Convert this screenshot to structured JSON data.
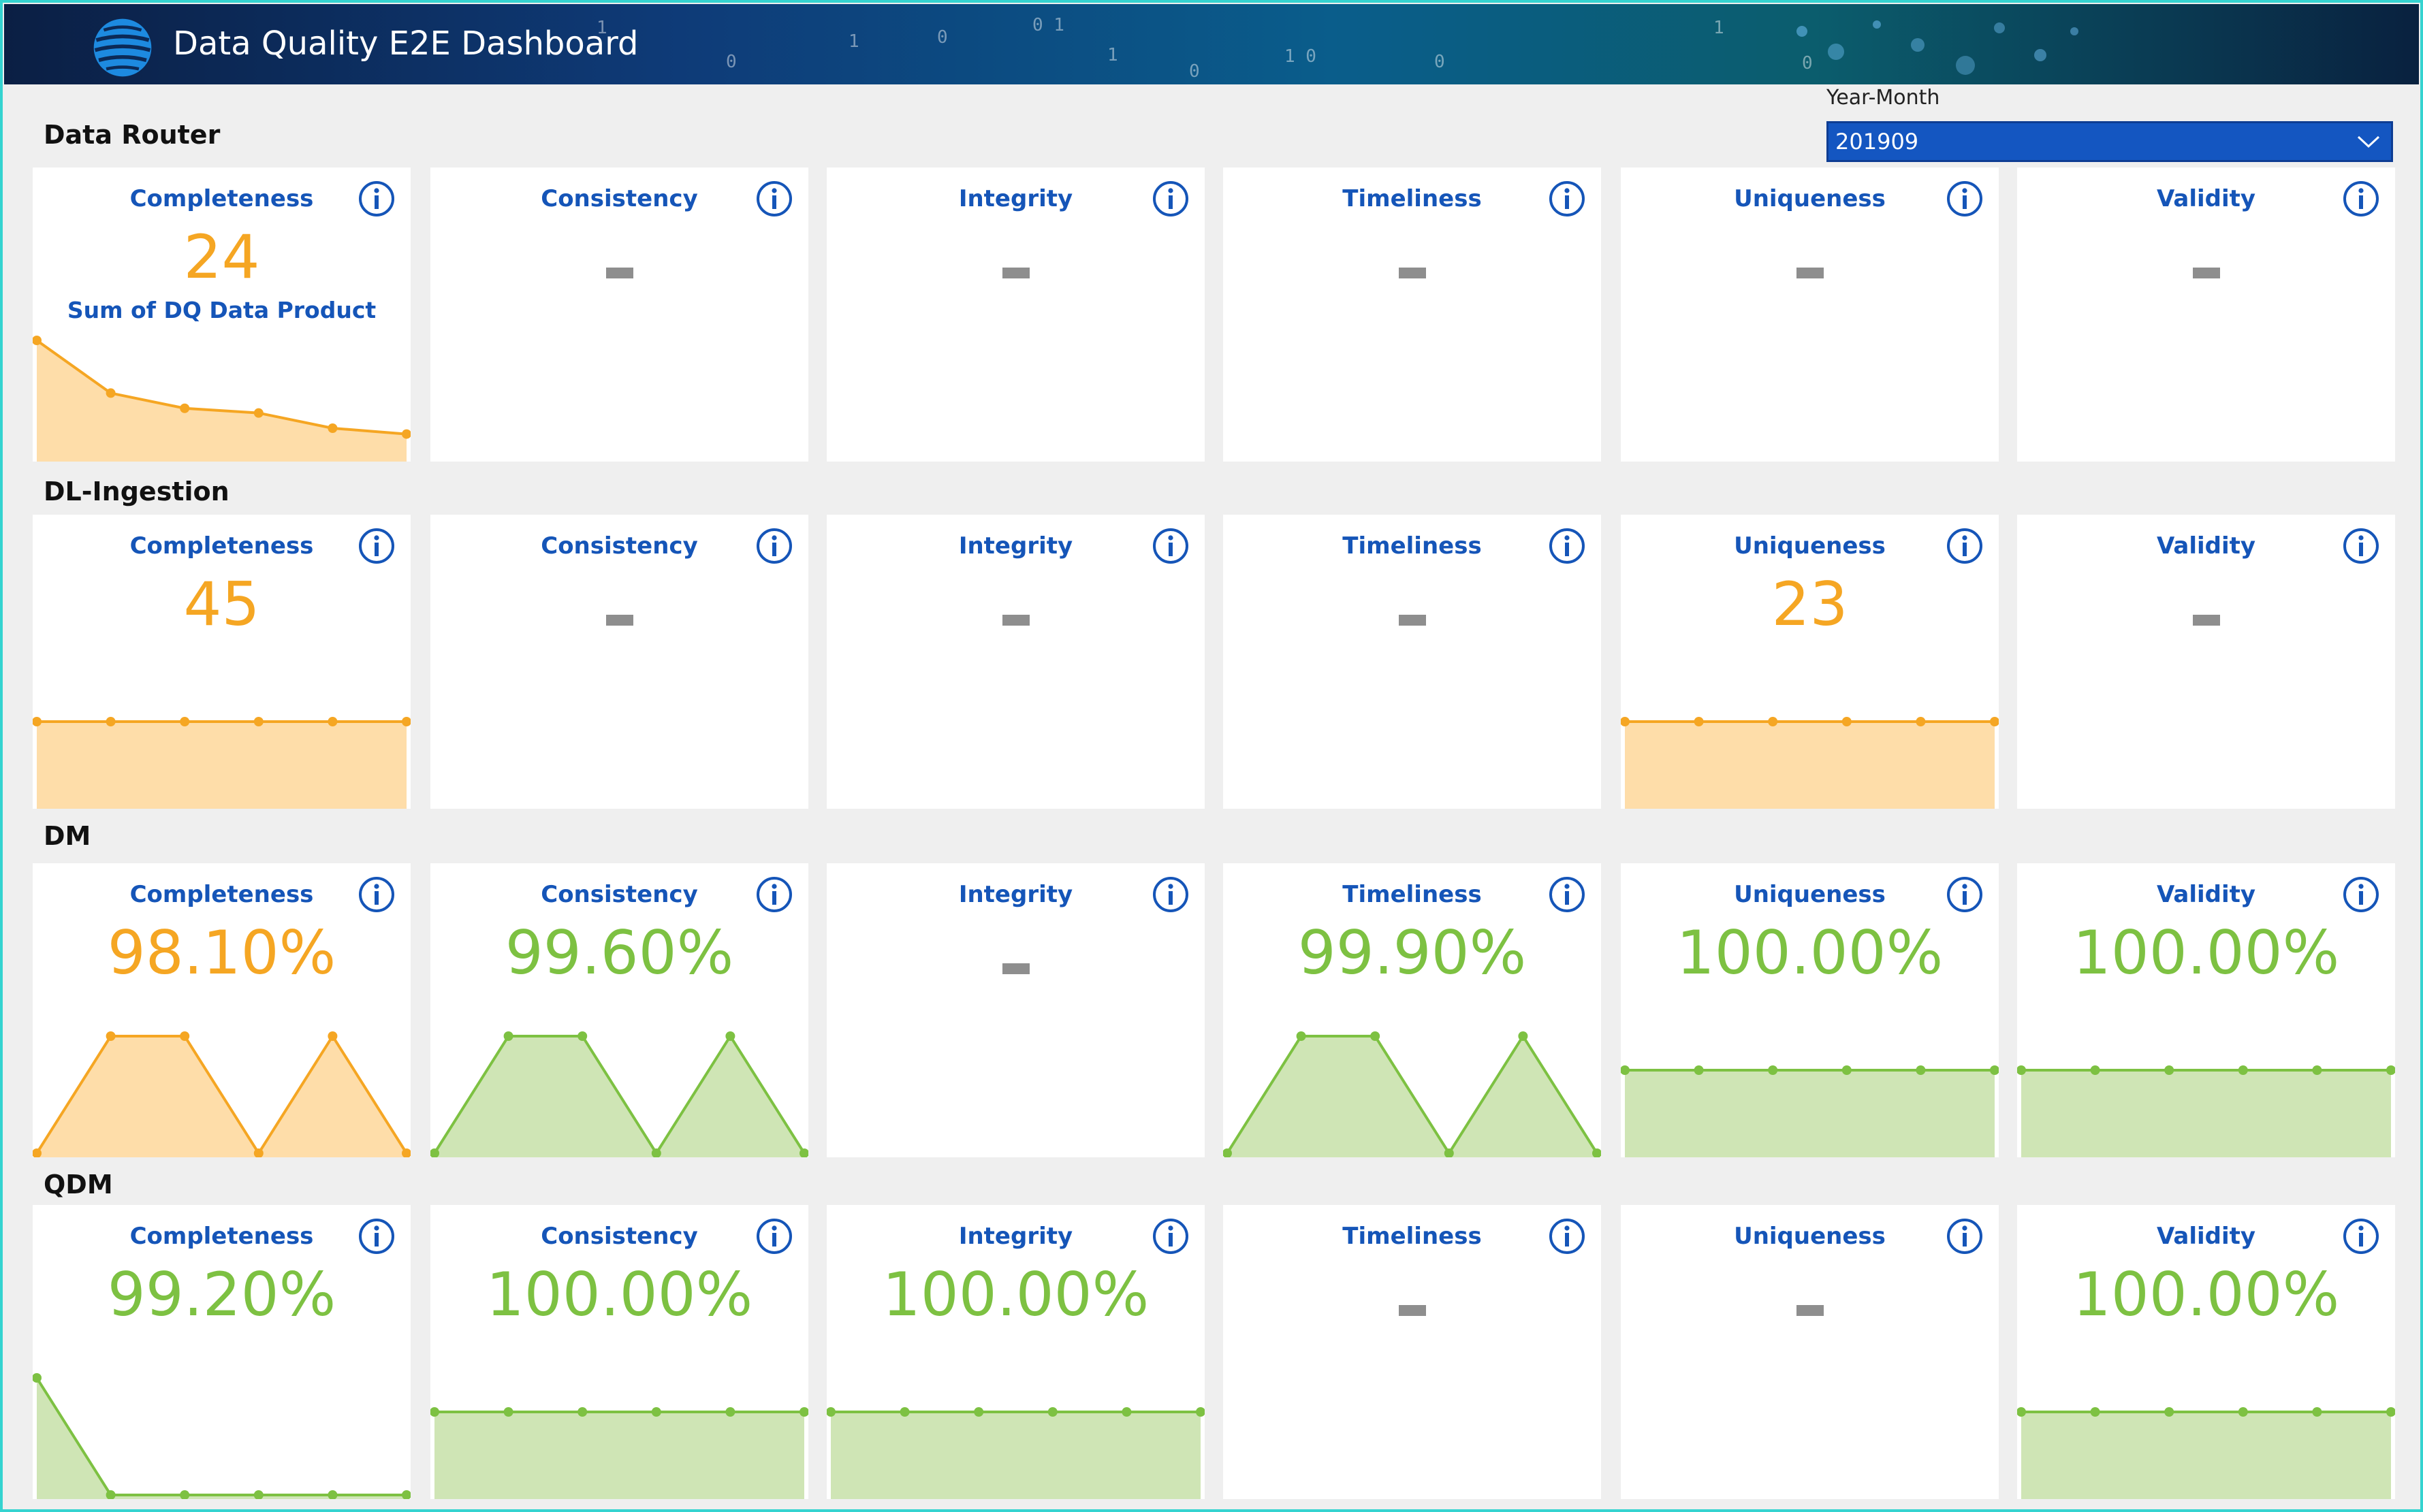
{
  "app": {
    "title": "Data Quality E2E Dashboard"
  },
  "filter": {
    "label": "Year-Month",
    "value": "201909"
  },
  "colors": {
    "amber": "#f5a623",
    "amber_fill": "#fedda9",
    "green": "#7dc142",
    "green_fill": "#cfe5b5",
    "title_blue": "#1555b8"
  },
  "sections": [
    {
      "label": "Data Router",
      "cards": [
        {
          "title": "Completeness",
          "value": "24",
          "sublabel": "Sum of DQ Data Product",
          "color": "amber",
          "spark": [
            1.0,
            0.55,
            0.42,
            0.38,
            0.25,
            0.2
          ]
        },
        {
          "title": "Consistency",
          "value": null
        },
        {
          "title": "Integrity",
          "value": null
        },
        {
          "title": "Timeliness",
          "value": null
        },
        {
          "title": "Uniqueness",
          "value": null
        },
        {
          "title": "Validity",
          "value": null
        }
      ]
    },
    {
      "label": "DL-Ingestion",
      "cards": [
        {
          "title": "Completeness",
          "value": "45",
          "color": "amber",
          "spark": [
            1,
            1,
            1,
            1,
            1,
            1
          ]
        },
        {
          "title": "Consistency",
          "value": null
        },
        {
          "title": "Integrity",
          "value": null
        },
        {
          "title": "Timeliness",
          "value": null
        },
        {
          "title": "Uniqueness",
          "value": "23",
          "color": "amber",
          "spark": [
            1,
            1,
            1,
            1,
            1,
            1
          ]
        },
        {
          "title": "Validity",
          "value": null
        }
      ]
    },
    {
      "label": "DM",
      "cards": [
        {
          "title": "Completeness",
          "value": "98.10%",
          "color": "amber",
          "spark": [
            0,
            1,
            1,
            0,
            1,
            0
          ]
        },
        {
          "title": "Consistency",
          "value": "99.60%",
          "color": "green",
          "spark": [
            0,
            1,
            1,
            0,
            1,
            0
          ]
        },
        {
          "title": "Integrity",
          "value": null
        },
        {
          "title": "Timeliness",
          "value": "99.90%",
          "color": "green",
          "spark": [
            0,
            1,
            1,
            0,
            1,
            0
          ]
        },
        {
          "title": "Uniqueness",
          "value": "100.00%",
          "color": "green",
          "spark": [
            1,
            1,
            1,
            1,
            1,
            1
          ]
        },
        {
          "title": "Validity",
          "value": "100.00%",
          "color": "green",
          "spark": [
            1,
            1,
            1,
            1,
            1,
            1
          ]
        }
      ]
    },
    {
      "label": "QDM",
      "cards": [
        {
          "title": "Completeness",
          "value": "99.20%",
          "color": "green",
          "spark": [
            1,
            0,
            0,
            0,
            0,
            0
          ]
        },
        {
          "title": "Consistency",
          "value": "100.00%",
          "color": "green",
          "spark": [
            1,
            1,
            1,
            1,
            1,
            1
          ]
        },
        {
          "title": "Integrity",
          "value": "100.00%",
          "color": "green",
          "spark": [
            1,
            1,
            1,
            1,
            1,
            1
          ]
        },
        {
          "title": "Timeliness",
          "value": null
        },
        {
          "title": "Uniqueness",
          "value": null
        },
        {
          "title": "Validity",
          "value": "100.00%",
          "color": "green",
          "spark": [
            1,
            1,
            1,
            1,
            1,
            1
          ]
        }
      ]
    }
  ]
}
